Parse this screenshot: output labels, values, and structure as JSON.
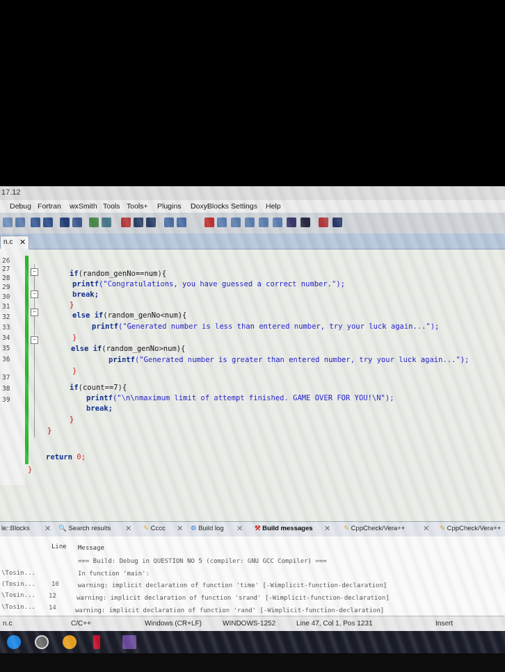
{
  "window": {
    "title_fragment": "17.12"
  },
  "menu": [
    "Debug",
    "Fortran",
    "wxSmith",
    "Tools",
    "Tools+",
    "Plugins",
    "DoxyBlocks",
    "Settings",
    "Help"
  ],
  "editor": {
    "tab": {
      "label": "n.c",
      "close": "✕"
    },
    "line_numbers": [
      "26",
      "27",
      "28",
      "29",
      "30",
      "31",
      "32",
      "33",
      "34",
      "35",
      "36",
      "37",
      "38",
      "39"
    ],
    "code": {
      "l1_kw": "if",
      "l1_rest": "(random_genNo==num){",
      "l2_fn": "printf",
      "l2_str": "(\"Congratulations, you have guessed a correct number.\");",
      "l3_kw": "break;",
      "l4": "}",
      "l5_kw": "else if",
      "l5_rest": "(random_genNo<num){",
      "l6_fn": "printf",
      "l6_str": "(\"Generated number is less than entered number, try your luck again...\");",
      "l7": "}",
      "l8_kw": "else if",
      "l8_rest": "(random_genNo>num){",
      "l9_fn": "printf",
      "l9_str": "(\"Generated number is greater than entered number, try your luck again...\");",
      "l10": "}",
      "l11_kw": "if",
      "l11_rest": "(count==7){",
      "l12_fn": "printf",
      "l12_str": "(\"\\n\\nmaximum limit of attempt finished. GAME OVER FOR YOU!\\N\");",
      "l13_kw": "break;",
      "l14": "}",
      "l15": "}",
      "l16_kw": "return",
      "l16_rest": "0;",
      "l17": "}"
    }
  },
  "bottom_tabs": {
    "doxyblocks": "le::Blocks",
    "search": "Search results",
    "cccc": "Cccc",
    "buildlog": "Build log",
    "buildmessages": "Build messages",
    "cppcheck1": "CppCheck/Vera++",
    "cppcheck2": "CppCheck/Vera++"
  },
  "messages": {
    "col_line": "Line",
    "col_message": "Message",
    "rows": [
      {
        "file": "",
        "line": "",
        "text": "=== Build: Debug in QUESTION NO 5 (compiler: GNU GCC Compiler) ==="
      },
      {
        "file": "\\Tosin...",
        "line": "",
        "text": "In function 'main':"
      },
      {
        "file": "(Tosin...",
        "line": "10",
        "text": "warning: implicit declaration of function 'time' [-Wimplicit-function-declaration]"
      },
      {
        "file": "\\Tosin...",
        "line": "12",
        "text": "warning: implicit declaration of function 'srand' [-Wimplicit-function-declaration]"
      },
      {
        "file": "\\Tosin...",
        "line": "14",
        "text": "warning: implicit declaration of function 'rand' [-Wimplicit-function-declaration]"
      }
    ]
  },
  "status": {
    "file": "n.c",
    "lang": "C/C++",
    "eol": "Windows (CR+LF)",
    "encoding": "WINDOWS-1252",
    "position": "Line 47, Col 1, Pos 1231",
    "mode": "Insert"
  },
  "colors": {
    "keyword": "#0b2a8a",
    "string": "#1a1ac8",
    "changebar": "#2eb82e"
  }
}
